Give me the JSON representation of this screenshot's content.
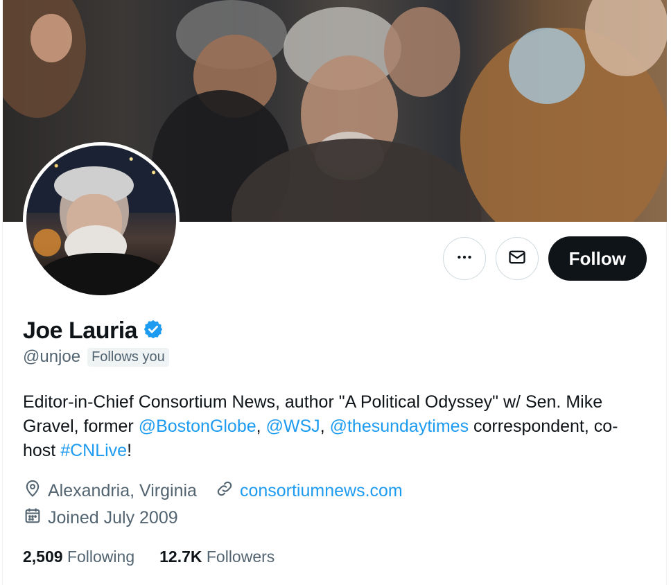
{
  "profile": {
    "display_name": "Joe Lauria",
    "handle": "@unjoe",
    "follows_you": "Follows you",
    "bio": {
      "part1": "Editor-in-Chief Consortium News, author \"A Political  Odyssey\" w/ Sen. Mike Gravel, former ",
      "mention1": "@BostonGlobe",
      "sep1": ", ",
      "mention2": "@WSJ",
      "sep2": ", ",
      "mention3": "@thesundaytimes",
      "part2": " correspondent, co-host ",
      "hashtag": "#CNLive",
      "part3": "!"
    },
    "location": "Alexandria, Virginia",
    "website": "consortiumnews.com",
    "joined": "Joined July 2009",
    "following_count": "2,509",
    "following_label": "Following",
    "followers_count": "12.7K",
    "followers_label": "Followers"
  },
  "actions": {
    "more_icon": "more-horizontal-icon",
    "message_icon": "envelope-icon",
    "follow_label": "Follow"
  },
  "colors": {
    "text": "#0f1419",
    "secondary": "#536471",
    "link": "#1d9bf0",
    "verified": "#1d9bf0",
    "button_dark": "#0f1419"
  }
}
